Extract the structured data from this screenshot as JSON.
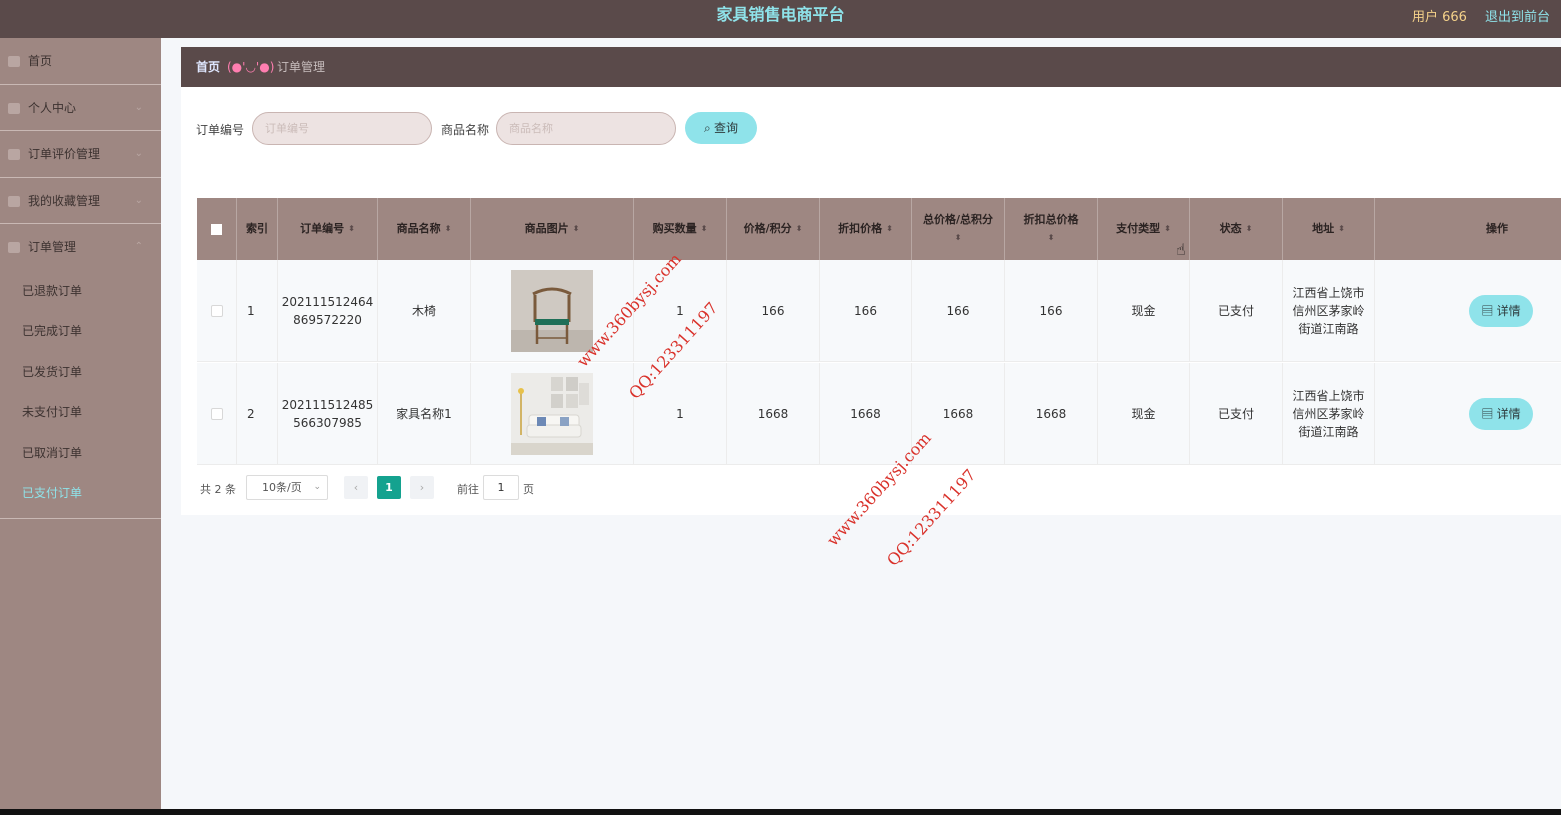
{
  "header": {
    "title": "家具销售电商平台",
    "user": "用户 666",
    "logout": "退出到前台"
  },
  "sidebar": {
    "items": [
      {
        "label": "首页"
      },
      {
        "label": "个人中心"
      },
      {
        "label": "订单评价管理"
      },
      {
        "label": "我的收藏管理"
      },
      {
        "label": "订单管理"
      }
    ],
    "sub_items": [
      {
        "label": "已退款订单"
      },
      {
        "label": "已完成订单"
      },
      {
        "label": "已发货订单"
      },
      {
        "label": "未支付订单"
      },
      {
        "label": "已取消订单"
      },
      {
        "label": "已支付订单"
      }
    ],
    "active_sub": "已支付订单"
  },
  "breadcrumb": {
    "home": "首页",
    "face": "(●'◡'●)",
    "current": "订单管理"
  },
  "search": {
    "order_no_label": "订单编号",
    "order_no_placeholder": "订单编号",
    "product_label": "商品名称",
    "product_placeholder": "商品名称",
    "query_button": "查询"
  },
  "table": {
    "headers": {
      "index": "索引",
      "order_no": "订单编号",
      "product": "商品名称",
      "image": "商品图片",
      "qty": "购买数量",
      "price": "价格/积分",
      "discount": "折扣价格",
      "total": "总价格/总积分",
      "discount_total": "折扣总价格",
      "pay_type": "支付类型",
      "status": "状态",
      "address": "地址",
      "action": "操作"
    },
    "rows": [
      {
        "index": "1",
        "order_no_1": "202111512464",
        "order_no_2": "869572220",
        "product": "木椅",
        "qty": "1",
        "price": "166",
        "discount": "166",
        "total": "166",
        "discount_total": "166",
        "pay_type": "现金",
        "status": "已支付",
        "addr_1": "江西省上饶市",
        "addr_2": "信州区茅家岭",
        "addr_3": "街道江南路",
        "action": "详情"
      },
      {
        "index": "2",
        "order_no_1": "202111512485",
        "order_no_2": "566307985",
        "product": "家具名称1",
        "qty": "1",
        "price": "1668",
        "discount": "1668",
        "total": "1668",
        "discount_total": "1668",
        "pay_type": "现金",
        "status": "已支付",
        "addr_1": "江西省上饶市",
        "addr_2": "信州区茅家岭",
        "addr_3": "街道江南路",
        "action": "详情"
      }
    ]
  },
  "pagination": {
    "total": "共 2 条",
    "page_size": "10条/页",
    "current_page": "1",
    "goto_label": "前往",
    "goto_value": "1",
    "page_suffix": "页"
  },
  "watermark": {
    "site": "www.360bysj.com",
    "qq": "QQ:123311197"
  },
  "colors": {
    "topbar": "#5a4a4a",
    "sidebar": "#9e8782",
    "accent": "#8fe3ea",
    "active_page": "#14a28f"
  }
}
